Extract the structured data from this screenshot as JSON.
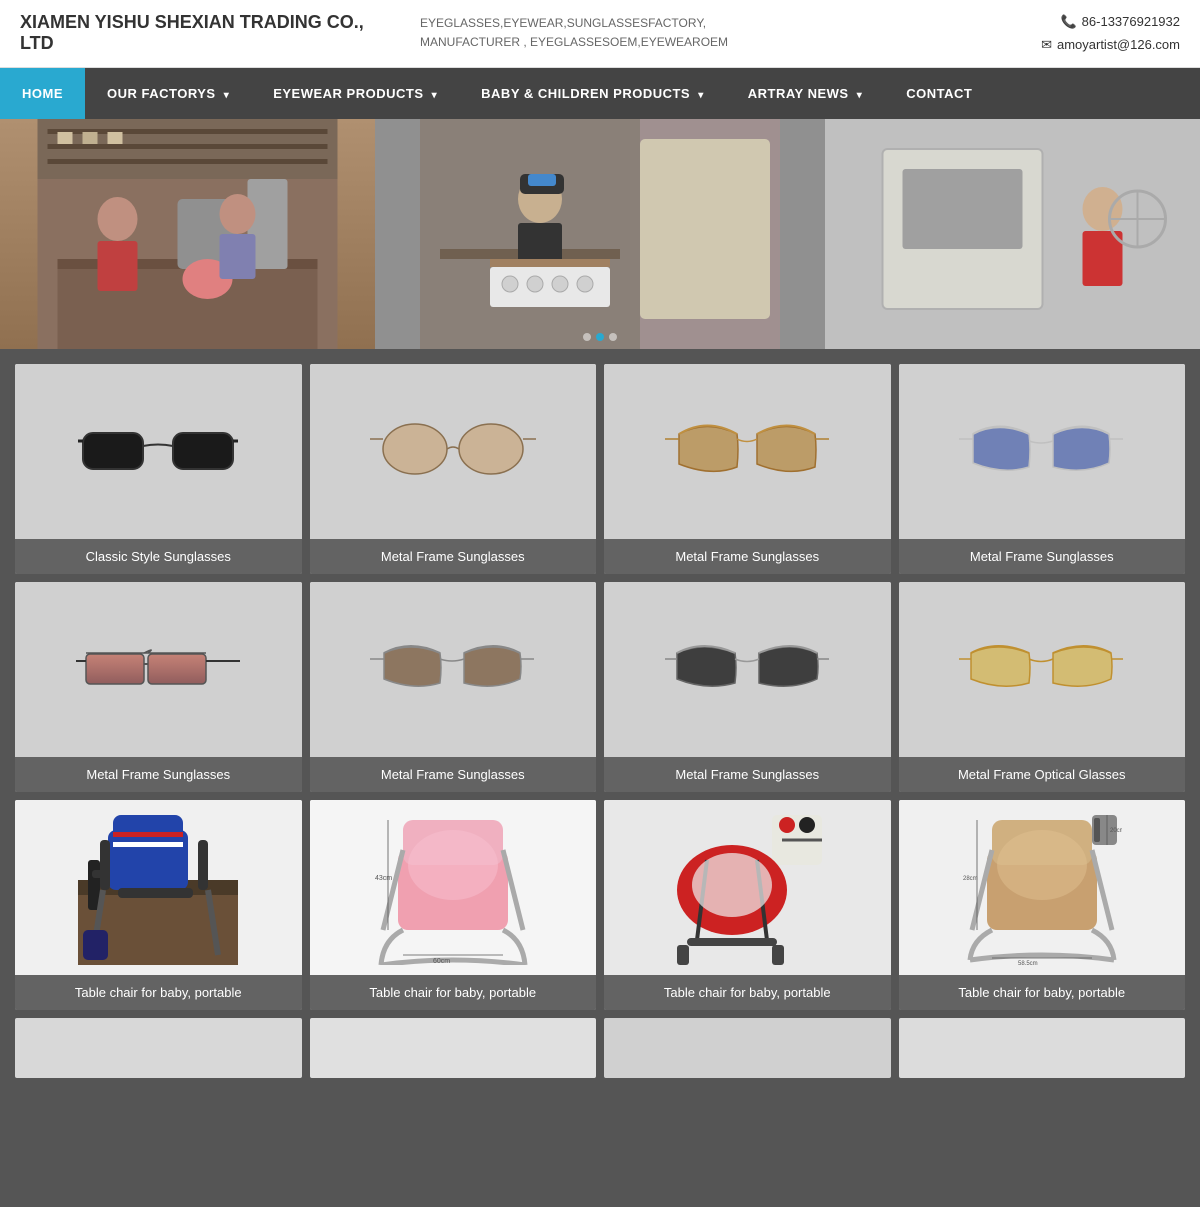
{
  "header": {
    "logo": "XIAMEN YISHU SHEXIAN TRADING CO., LTD",
    "tagline_line1": "EYEGLASSES,EYEWEAR,SUNGLASSESFACTORY,",
    "tagline_line2": "MANUFACTURER , EYEGLASSESOEM,EYEWEAROEM",
    "phone": "86-13376921932",
    "email": "amoyartist@126.com"
  },
  "nav": {
    "items": [
      {
        "label": "HOME",
        "active": true,
        "has_arrow": false
      },
      {
        "label": "OUR FACTORYS",
        "active": false,
        "has_arrow": true
      },
      {
        "label": "EYEWEAR PRODUCTS",
        "active": false,
        "has_arrow": true
      },
      {
        "label": "BABY & CHILDREN PRODUCTS",
        "active": false,
        "has_arrow": true
      },
      {
        "label": "ARTRAY NEWS",
        "active": false,
        "has_arrow": true
      },
      {
        "label": "CONTACT",
        "active": false,
        "has_arrow": false
      }
    ]
  },
  "products_row1": [
    {
      "label": "Classic Style Sunglasses",
      "type": "classic"
    },
    {
      "label": "Metal Frame Sunglasses",
      "type": "metal-round"
    },
    {
      "label": "Metal Frame Sunglasses",
      "type": "metal-aviator-brown"
    },
    {
      "label": "Metal Frame Sunglasses",
      "type": "metal-aviator-blue"
    }
  ],
  "products_row2": [
    {
      "label": "Metal Frame Sunglasses",
      "type": "metal-rect-red"
    },
    {
      "label": "Metal Frame Sunglasses",
      "type": "metal-aviator-dark"
    },
    {
      "label": "Metal Frame Sunglasses",
      "type": "metal-aviator-black"
    },
    {
      "label": "Metal Frame Optical Glasses",
      "type": "metal-optical-yellow"
    }
  ],
  "products_row3": [
    {
      "label": "Table chair for baby, portable",
      "type": "baby-blue"
    },
    {
      "label": "Table chair for baby, portable",
      "type": "baby-pink"
    },
    {
      "label": "Table chair for baby, portable",
      "type": "baby-red"
    },
    {
      "label": "Table chair for baby, portable",
      "type": "baby-brown"
    }
  ]
}
